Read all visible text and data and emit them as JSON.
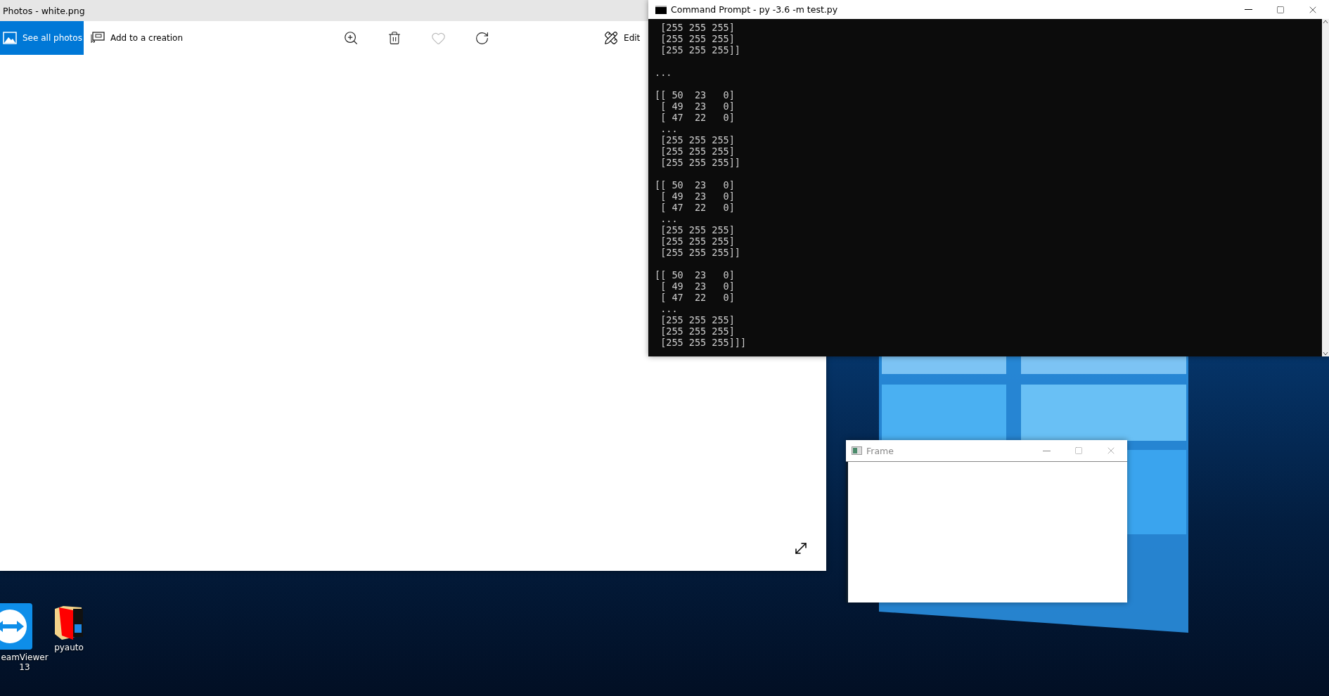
{
  "photos_window": {
    "title": "Photos - white.png",
    "see_all_label": "See all photos",
    "add_label": "Add to a creation",
    "edit_label": "Edit"
  },
  "cmd_window": {
    "title": "Command Prompt - py  -3.6 -m test.py",
    "blocks": [
      [
        " [255 255 255]",
        " [255 255 255]",
        " [255 255 255]]"
      ],
      [
        "..."
      ],
      [
        "[[ 50  23   0]",
        " [ 49  23   0]",
        " [ 47  22   0]",
        " ...",
        " [255 255 255]",
        " [255 255 255]",
        " [255 255 255]]"
      ],
      [
        "[[ 50  23   0]",
        " [ 49  23   0]",
        " [ 47  22   0]",
        " ...",
        " [255 255 255]",
        " [255 255 255]",
        " [255 255 255]]"
      ],
      [
        "[[ 50  23   0]",
        " [ 49  23   0]",
        " [ 47  22   0]",
        " ...",
        " [255 255 255]",
        " [255 255 255]",
        " [255 255 255]]]"
      ]
    ]
  },
  "frame_window": {
    "title": "Frame"
  },
  "desktop_icons": [
    {
      "kind": "teamviewer",
      "label": "eamViewer 13"
    },
    {
      "kind": "folder",
      "label": "pyauto"
    }
  ]
}
